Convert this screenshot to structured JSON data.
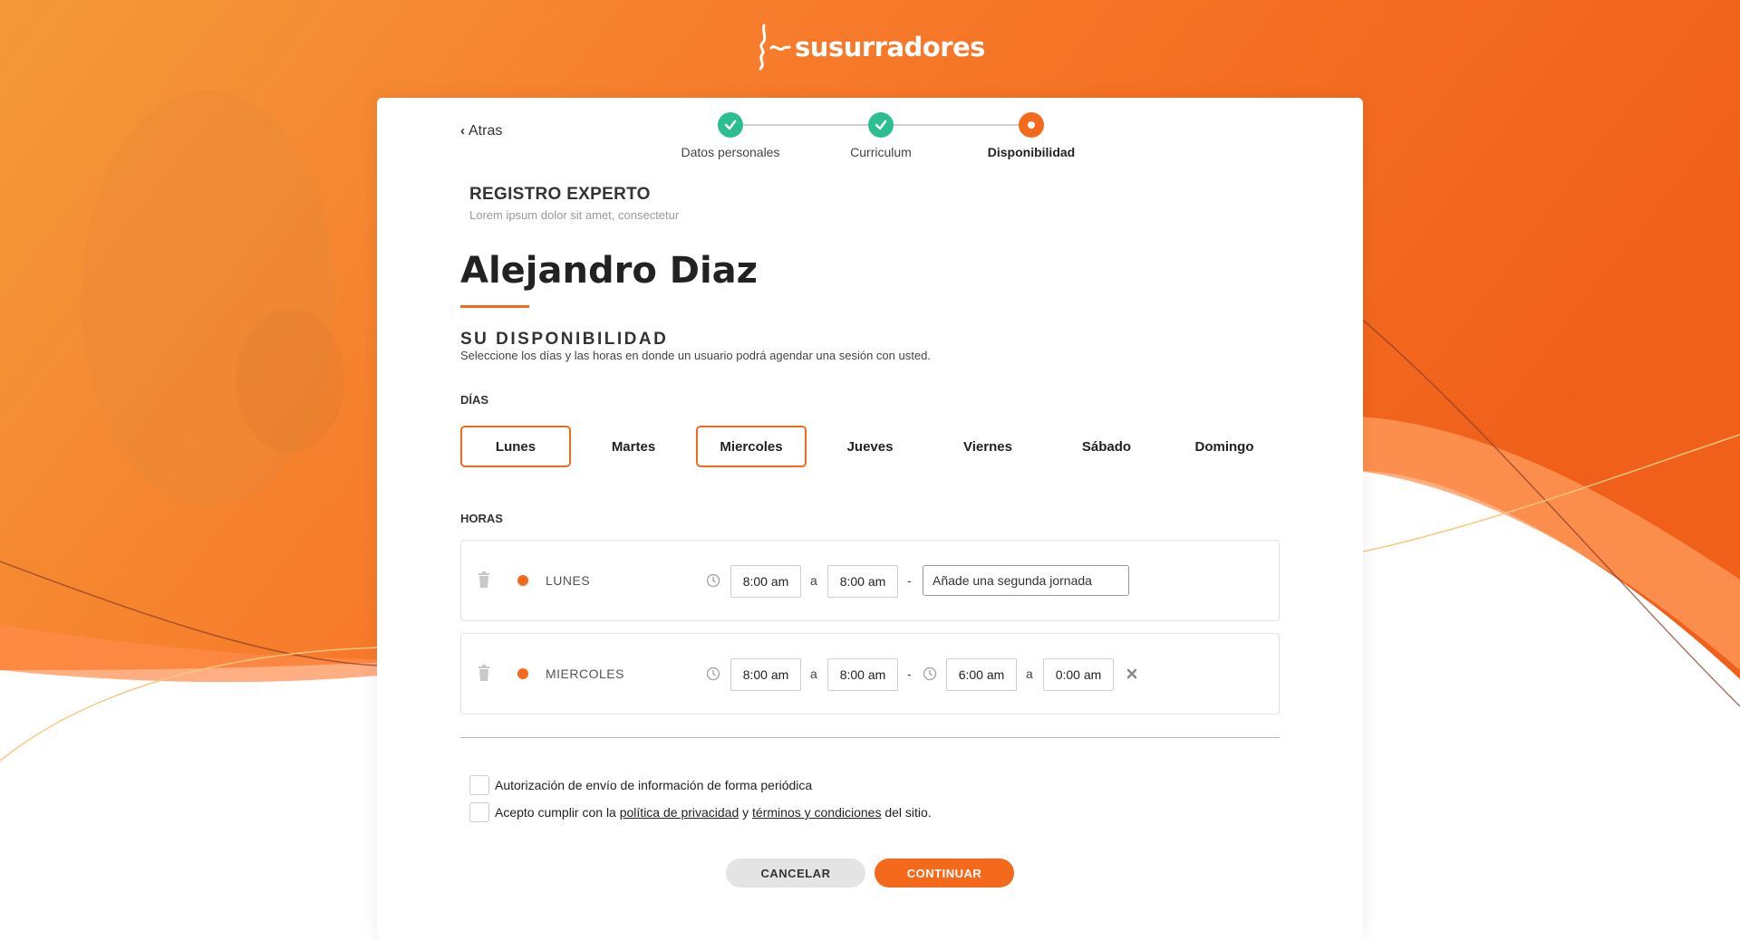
{
  "brand": {
    "name": "susurradores",
    "accent": "#f4691c",
    "success": "#2bbf8f"
  },
  "nav": {
    "back_label": "Atras"
  },
  "stepper": [
    {
      "label": "Datos personales",
      "status": "done"
    },
    {
      "label": "Curriculum",
      "status": "done"
    },
    {
      "label": "Disponibilidad",
      "status": "current"
    }
  ],
  "header": {
    "title": "REGISTRO EXPERTO",
    "subtitle": "Lorem ipsum dolor sit amet, consectetur"
  },
  "user": {
    "name": "Alejandro Diaz"
  },
  "availability": {
    "title": "SU DISPONIBILIDAD",
    "subtitle": "Seleccione los días y las horas en donde un usuario podrá agendar una sesión con usted.",
    "days_label": "DÍAS",
    "hours_label": "HORAS",
    "days": [
      {
        "label": "Lunes",
        "selected": true
      },
      {
        "label": "Martes",
        "selected": false
      },
      {
        "label": "Miercoles",
        "selected": true
      },
      {
        "label": "Jueves",
        "selected": false
      },
      {
        "label": "Viernes",
        "selected": false
      },
      {
        "label": "Sábado",
        "selected": false
      },
      {
        "label": "Domingo",
        "selected": false
      }
    ],
    "rows": [
      {
        "day": "LUNES",
        "shift1": {
          "from": "8:00 am",
          "to": "8:00 am"
        },
        "add_second": "Añade una segunda jornada"
      },
      {
        "day": "MIERCOLES",
        "shift1": {
          "from": "8:00 am",
          "to": "8:00 am"
        },
        "shift2": {
          "from": "6:00 am",
          "to": "0:00 am"
        }
      }
    ],
    "range_sep": "a",
    "shift_sep": "-"
  },
  "consent": {
    "periodic": "Autorización de envío de información de forma periódica",
    "terms_prefix": "Acepto cumplir con la",
    "privacy_link": "política de privacidad",
    "terms_mid": "y",
    "terms_link": "términos y condiciones",
    "terms_suffix": "del sitio."
  },
  "actions": {
    "cancel": "CANCELAR",
    "continue": "CONTINUAR"
  },
  "icons": [
    "logo-face-icon",
    "chevron-left-icon",
    "check-icon",
    "trash-icon",
    "clock-icon",
    "close-icon"
  ]
}
